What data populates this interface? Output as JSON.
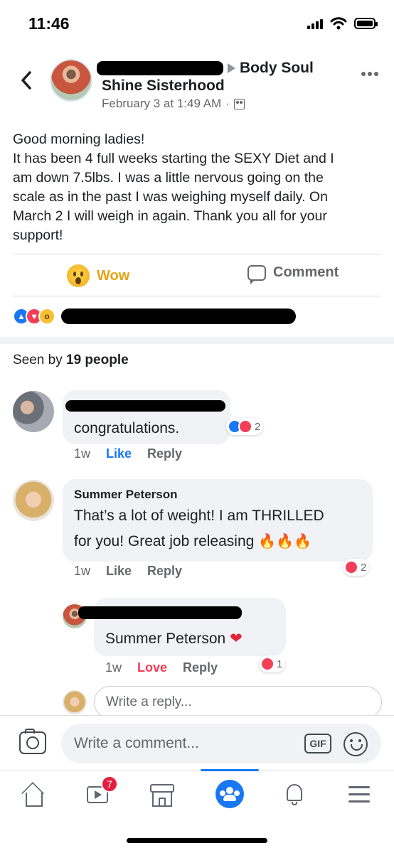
{
  "status_bar": {
    "time": "11:46"
  },
  "post": {
    "group_name_line1": "Body Soul",
    "group_name_line2": "Shine Sisterhood",
    "timestamp": "February 3 at 1:49 AM",
    "meta_separator": "·",
    "privacy_icon": "members-icon",
    "body": [
      "Good morning ladies!",
      "It has been 4 full weeks starting the SEXY Diet and I",
      "am down 7.5lbs. I was a little nervous going on the",
      "scale as in the past I was weighing myself daily. On",
      "March 2 I will weigh in again. Thank you all for your",
      "support!"
    ]
  },
  "actions": {
    "reaction_label": "Wow",
    "comment_label": "Comment"
  },
  "seen_by": {
    "prefix": "Seen by",
    "count_text": "19 people"
  },
  "comments": [
    {
      "text": "congratulations.",
      "time": "1w",
      "like_label": "Like",
      "reply_label": "Reply",
      "reaction_count": "2",
      "reactions": [
        "like",
        "love"
      ],
      "user_liked": true
    },
    {
      "author": "Summer Peterson",
      "text_line1": "That’s a lot of weight! I  am THRILLED",
      "text_line2": "for you! Great job releasing",
      "emoji": "🔥🔥🔥",
      "time": "1w",
      "like_label": "Like",
      "reply_label": "Reply",
      "reaction_count": "2",
      "reactions": [
        "love"
      ]
    }
  ],
  "reply": {
    "mention": "Summer Peterson",
    "emoji": "❤",
    "time": "1w",
    "love_label": "Love",
    "reply_label": "Reply",
    "reaction_count": "1",
    "reactions": [
      "love"
    ]
  },
  "reply_input": {
    "placeholder": "Write a reply..."
  },
  "composer": {
    "placeholder": "Write a comment...",
    "gif_label": "GIF"
  },
  "tab_bar": {
    "watch_badge": "7",
    "active_tab": "groups"
  },
  "colors": {
    "accent": "#1877f2",
    "love": "#f33e58",
    "wow": "#f7c031",
    "secondary_text": "#65676b",
    "bubble": "#f0f2f5"
  }
}
